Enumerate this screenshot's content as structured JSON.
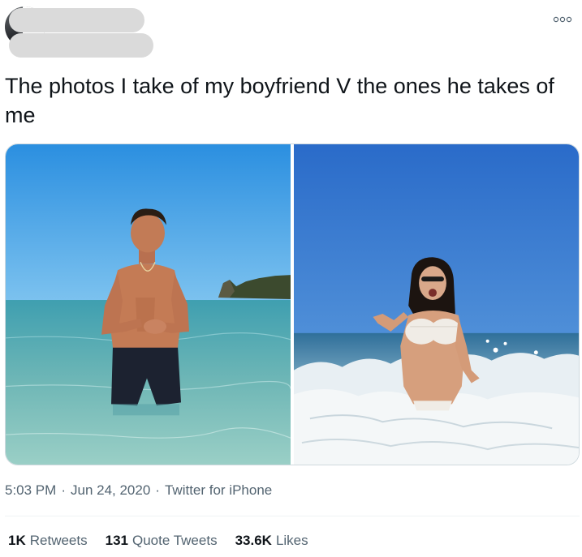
{
  "tweet": {
    "text": "The photos I take of my boyfriend V the ones he takes of me",
    "timestamp": "5:03 PM",
    "date": "Jun 24, 2020",
    "separator": "·",
    "source": "Twitter for iPhone",
    "stats": [
      {
        "count": "1K",
        "label": "Retweets"
      },
      {
        "count": "131",
        "label": "Quote Tweets"
      },
      {
        "count": "33.6K",
        "label": "Likes"
      }
    ]
  },
  "icons": {
    "more": "more-options-icon"
  },
  "colors": {
    "text_primary": "#0f1419",
    "text_secondary": "#536471",
    "redaction": "#dadada",
    "divider": "#eff3f4"
  }
}
